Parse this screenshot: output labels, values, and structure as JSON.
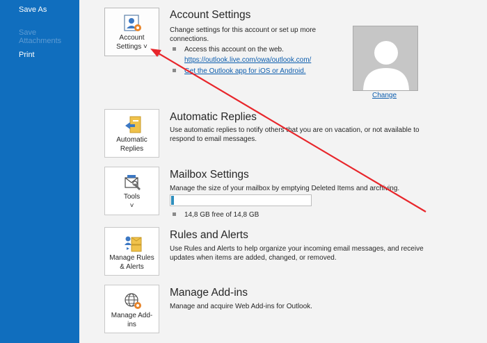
{
  "sidebar": {
    "items": [
      {
        "label": "Save As",
        "enabled": true
      },
      {
        "label": "Save Attachments",
        "enabled": false
      },
      {
        "label": "Print",
        "enabled": true
      }
    ]
  },
  "account_settings": {
    "tile_line1": "Account",
    "tile_line2": "Settings ˅",
    "title": "Account Settings",
    "desc": "Change settings for this account or set up more connections.",
    "bullet1": "Access this account on the web.",
    "link1": "https://outlook.live.com/owa/outlook.com/",
    "link2": "Get the Outlook app for iOS or Android.",
    "change_label": "Change"
  },
  "automatic_replies": {
    "tile_line1": "Automatic",
    "tile_line2": "Replies",
    "title": "Automatic Replies",
    "desc": "Use automatic replies to notify others that you are on vacation, or not available to respond to email messages."
  },
  "mailbox_settings": {
    "tile_line1": "Tools",
    "tile_line2": "˅",
    "title": "Mailbox Settings",
    "desc": "Manage the size of your mailbox by emptying Deleted Items and archiving.",
    "usage_text": "14,8 GB free of 14,8 GB",
    "used_fraction": 0.02
  },
  "rules_alerts": {
    "tile_line1": "Manage Rules",
    "tile_line2": "& Alerts",
    "title": "Rules and Alerts",
    "desc": "Use Rules and Alerts to help organize your incoming email messages, and receive updates when items are added, changed, or removed."
  },
  "addins": {
    "tile_line1": "Manage Add-",
    "tile_line2": "ins",
    "title": "Manage Add-ins",
    "desc": "Manage and acquire Web Add-ins for Outlook."
  },
  "colors": {
    "sidebar": "#106ebe",
    "link": "#0b5cad",
    "annotation_arrow": "#e8262b",
    "progress_fill": "#2f8fbd"
  }
}
